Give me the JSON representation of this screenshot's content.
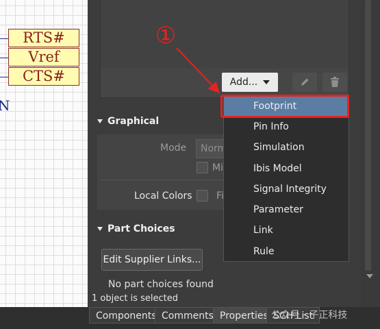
{
  "schematic": {
    "pins": [
      "RTS#",
      "Vref",
      "CTS#"
    ],
    "partial_label": "N"
  },
  "toolbar": {
    "add_label": "Add...",
    "edit_icon": "pencil-icon",
    "delete_icon": "trash-icon"
  },
  "dropdown": {
    "selected_index": 0,
    "items": [
      "Footprint",
      "Pin Info",
      "Simulation",
      "Ibis Model",
      "Signal Integrity",
      "Parameter",
      "Link",
      "Rule"
    ]
  },
  "graphical": {
    "heading": "Graphical",
    "mode_label": "Mode",
    "mode_value": "Norm",
    "mirrored_label": "Mi",
    "local_colors_label": "Local Colors",
    "fills_label": "Fi"
  },
  "part_choices": {
    "heading": "Part Choices",
    "edit_button": "Edit Supplier Links...",
    "empty_text": "No part choices found"
  },
  "status": {
    "text": "1 object is selected"
  },
  "tabs": [
    {
      "label": "Components",
      "active": false
    },
    {
      "label": "Comments",
      "active": false
    },
    {
      "label": "Properties",
      "active": true
    },
    {
      "label": "SCH List",
      "active": false
    }
  ],
  "watermark": "公众号 · 子正科技",
  "annotation": {
    "marker": "①",
    "color": "#e5231f"
  },
  "colors": {
    "selected_item": "#5b7da3",
    "panel": "#3c3c3c",
    "pin_fill": "#fffbb0",
    "pin_text": "#8a1f1f"
  }
}
